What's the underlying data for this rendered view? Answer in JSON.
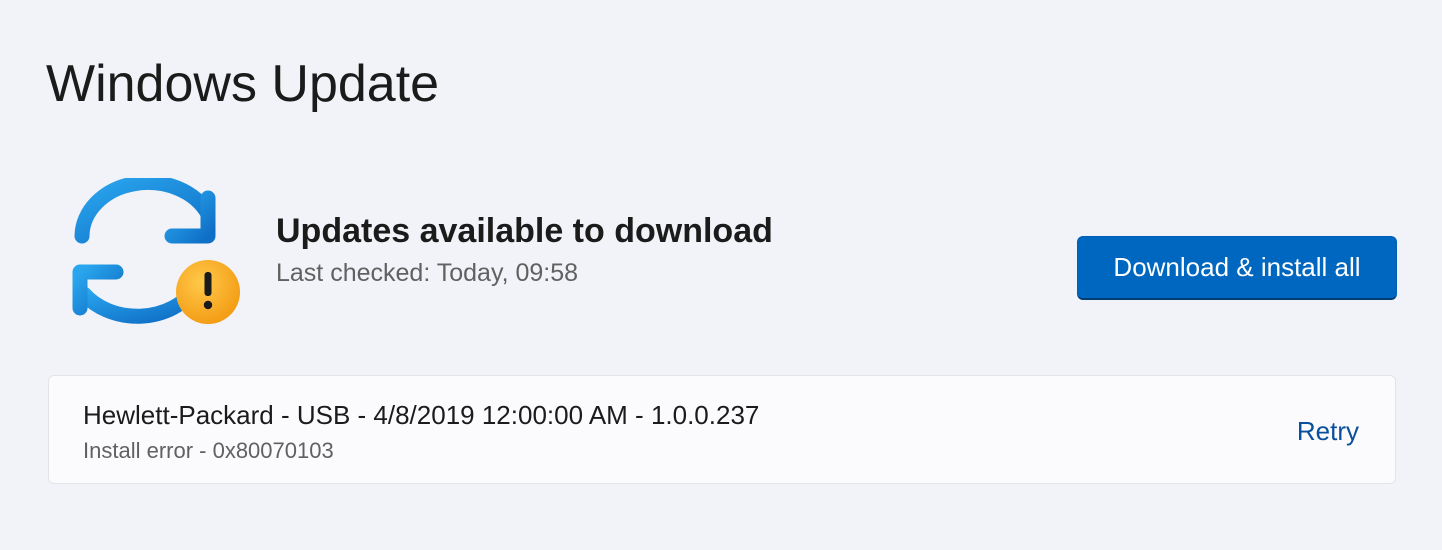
{
  "page": {
    "title": "Windows Update"
  },
  "status": {
    "icon": "sync-warning-icon",
    "heading": "Updates available to download",
    "last_checked": "Last checked: Today, 09:58",
    "action_label": "Download & install all"
  },
  "updates": [
    {
      "name": "Hewlett-Packard - USB - 4/8/2019 12:00:00 AM - 1.0.0.237",
      "status": "Install error - 0x80070103",
      "action_label": "Retry"
    }
  ],
  "colors": {
    "background": "#f1f3f8",
    "accent": "#0067c0",
    "sync_arrow": "#1a8fe0",
    "warning": "#f7a318",
    "link": "#0a4f9c"
  }
}
